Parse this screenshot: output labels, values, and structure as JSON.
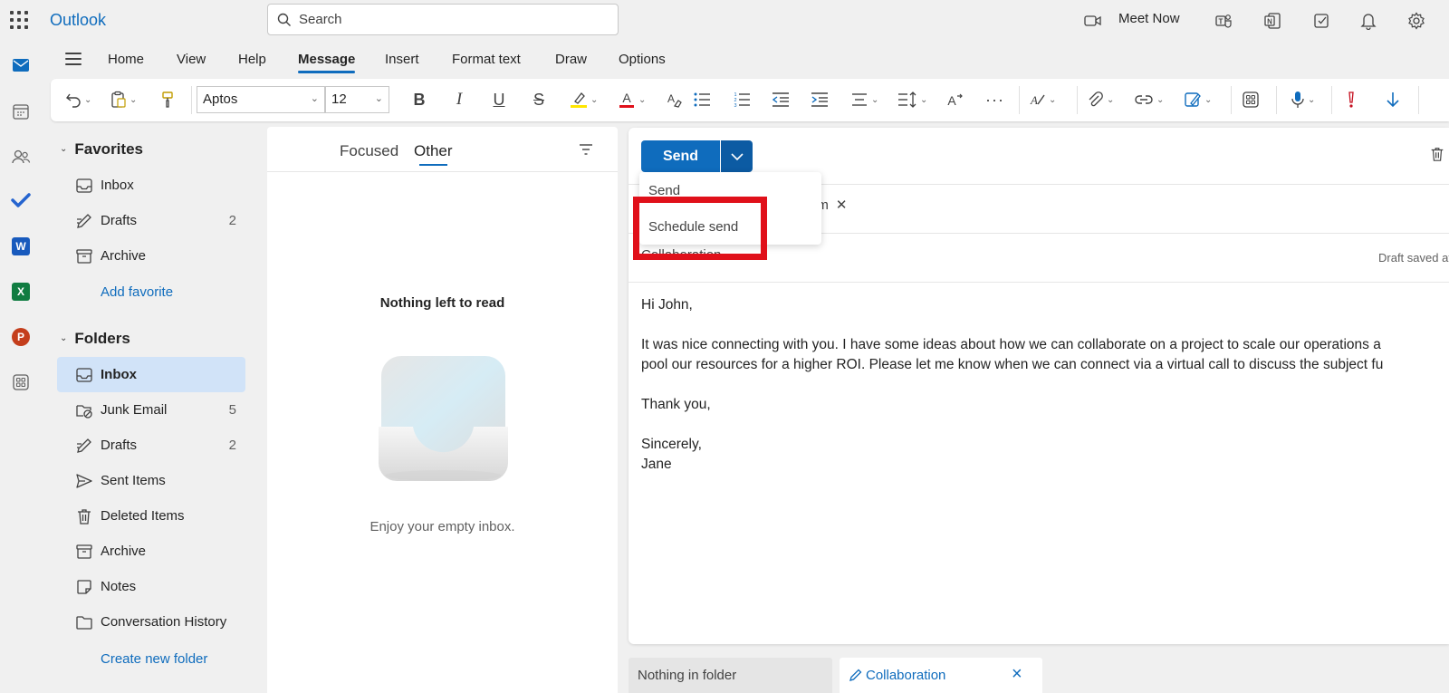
{
  "app": {
    "brand": "Outlook"
  },
  "search": {
    "placeholder": "Search"
  },
  "topbar": {
    "meet_now": "Meet Now"
  },
  "ribbon": {
    "tabs": [
      "Home",
      "View",
      "Help",
      "Message",
      "Insert",
      "Format text",
      "Draw",
      "Options"
    ],
    "active_tab": "Message",
    "font_name": "Aptos",
    "font_size": "12"
  },
  "nav": {
    "favorites_header": "Favorites",
    "favorites": [
      {
        "label": "Inbox",
        "count": ""
      },
      {
        "label": "Drafts",
        "count": "2"
      },
      {
        "label": "Archive",
        "count": ""
      }
    ],
    "add_favorite": "Add favorite",
    "folders_header": "Folders",
    "folders": [
      {
        "label": "Inbox",
        "count": ""
      },
      {
        "label": "Junk Email",
        "count": "5"
      },
      {
        "label": "Drafts",
        "count": "2"
      },
      {
        "label": "Sent Items",
        "count": ""
      },
      {
        "label": "Deleted Items",
        "count": ""
      },
      {
        "label": "Archive",
        "count": ""
      },
      {
        "label": "Notes",
        "count": ""
      },
      {
        "label": "Conversation History",
        "count": ""
      }
    ],
    "create_folder": "Create new folder"
  },
  "list": {
    "tab_focused": "Focused",
    "tab_other": "Other",
    "empty_title": "Nothing left to read",
    "empty_subtitle": "Enjoy your empty inbox."
  },
  "compose": {
    "send_label": "Send",
    "recipient_fragment": "om",
    "subject": "Collaboration",
    "draft_saved": "Draft saved at",
    "body_lines": [
      "Hi John,",
      "",
      "It was nice connecting with you. I have some ideas about how we can collaborate on a project to scale our operations a",
      "pool our resources for a higher ROI. Please let me know when we can connect via a virtual call to discuss the subject fu",
      "",
      "Thank you,",
      "",
      "Sincerely,",
      "Jane"
    ]
  },
  "send_menu": {
    "items": [
      "Send",
      "Schedule send"
    ]
  },
  "bottom_tabs": {
    "tab1": "Nothing in folder",
    "tab2": "Collaboration"
  },
  "colors": {
    "accent": "#0f6cbd",
    "highlight": "#e0101a",
    "selected_nav": "#d1e3f8"
  }
}
